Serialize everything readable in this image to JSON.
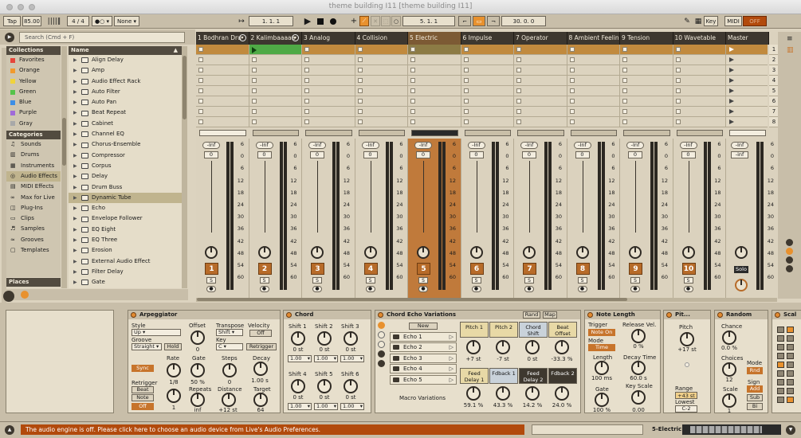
{
  "window": {
    "title": "theme building I11  [theme building I11]"
  },
  "control_bar": {
    "tap": "Tap",
    "tempo": "85.00",
    "time_sig": "4 / 4",
    "metronome": "1 Bar",
    "quantize": "None",
    "arrangement_pos": "1.   1.   1",
    "loop_start": "5.   1.   1",
    "loop_length": "30.   0.   0",
    "key_label": "Key",
    "midi_label": "MIDI",
    "cpu": "OFF"
  },
  "browser": {
    "search_placeholder": "Search (Cmd + F)",
    "collections_header": "Collections",
    "collections": [
      {
        "label": "Favorites",
        "color": "#e6453a"
      },
      {
        "label": "Orange",
        "color": "#f19a2d"
      },
      {
        "label": "Yellow",
        "color": "#f0d33b"
      },
      {
        "label": "Green",
        "color": "#55c34a"
      },
      {
        "label": "Blue",
        "color": "#3d8fe6"
      },
      {
        "label": "Purple",
        "color": "#a06ad8"
      },
      {
        "label": "Gray",
        "color": "#a8a8a8"
      }
    ],
    "categories_header": "Categories",
    "categories": [
      "Sounds",
      "Drums",
      "Instruments",
      "Audio Effects",
      "MIDI Effects",
      "Max for Live",
      "Plug-Ins",
      "Clips",
      "Samples",
      "Grooves",
      "Templates"
    ],
    "places_header": "Places",
    "name_header": "Name",
    "items": [
      "Align Delay",
      "Amp",
      "Audio Effect Rack",
      "Auto Filter",
      "Auto Pan",
      "Beat Repeat",
      "Cabinet",
      "Channel EQ",
      "Chorus-Ensemble",
      "Compressor",
      "Corpus",
      "Delay",
      "Drum Buss",
      "Dynamic Tube",
      "Echo",
      "Envelope Follower",
      "EQ Eight",
      "EQ Three",
      "Erosion",
      "External Audio Effect",
      "Filter Delay",
      "Gate"
    ]
  },
  "tracks": [
    {
      "name": "1 Bodhran Dru",
      "num": "1",
      "vol": "-Inf",
      "pan": "0"
    },
    {
      "name": "2 Kalimbaaaaa",
      "num": "2",
      "vol": "-Inf",
      "pan": "0"
    },
    {
      "name": "3 Analog",
      "num": "3",
      "vol": "-Inf",
      "pan": "0"
    },
    {
      "name": "4 Collision",
      "num": "4",
      "vol": "-Inf",
      "pan": "0"
    },
    {
      "name": "5 Electric",
      "num": "5",
      "vol": "-Inf",
      "pan": "0"
    },
    {
      "name": "6 Impulse",
      "num": "6",
      "vol": "-Inf",
      "pan": "0"
    },
    {
      "name": "7 Operator",
      "num": "7",
      "vol": "-Inf",
      "pan": "0"
    },
    {
      "name": "8 Ambient Feelin",
      "num": "8",
      "vol": "-Inf",
      "pan": "0"
    },
    {
      "name": "9 Tension",
      "num": "9",
      "vol": "-Inf",
      "pan": "0"
    },
    {
      "name": "10 Wavetable",
      "num": "10",
      "vol": "-Inf",
      "pan": "0"
    }
  ],
  "master": {
    "name": "Master",
    "vol": "-Inf",
    "pan": "-inf",
    "solo": "Solo"
  },
  "scenes": [
    "1",
    "2",
    "3",
    "4",
    "5",
    "6",
    "7",
    "8"
  ],
  "scale": [
    "6",
    "0",
    "6",
    "12",
    "18",
    "24",
    "30",
    "36",
    "42",
    "48",
    "54",
    "60"
  ],
  "mix_buttons": {
    "solo": "S"
  },
  "devices": {
    "arpeggiator": {
      "title": "Arpeggiator",
      "style_label": "Style",
      "style": "Up",
      "groove_label": "Groove",
      "groove": "Straight",
      "hold": "Hold",
      "offset_label": "Offset",
      "offset": "0",
      "transpose_label": "Transpose",
      "transpose": "Shift",
      "key_label": "Key",
      "key": "C",
      "velocity_label": "Velocity",
      "velocity": "Off",
      "retrigger_btn": "Retrigger",
      "sync": "Sync",
      "rate_label": "Rate",
      "rate": "1/8",
      "gate_label": "Gate",
      "gate": "50 %",
      "steps_label": "Steps",
      "steps": "0",
      "decay_label": "Decay",
      "decay": "1.00 s",
      "retrigger_label": "Retrigger",
      "retrig_beat": "Beat",
      "retrig_note": "Note",
      "retrig_off": "Off",
      "repeats_label": "Repeats",
      "repeats": "inf",
      "distance_label": "Distance",
      "distance": "+12 st",
      "target_label": "Target",
      "target": "64",
      "knob1": "1"
    },
    "chord": {
      "title": "Chord",
      "shifts": [
        {
          "label": "Shift 1",
          "val": "0 st",
          "vel": "1.00"
        },
        {
          "label": "Shift 2",
          "val": "0 st",
          "vel": "1.00"
        },
        {
          "label": "Shift 3",
          "val": "0 st",
          "vel": "1.00"
        },
        {
          "label": "Shift 4",
          "val": "0 st",
          "vel": "1.00"
        },
        {
          "label": "Shift 5",
          "val": "0 st",
          "vel": "1.00"
        },
        {
          "label": "Shift 6",
          "val": "0 st",
          "vel": "1.00"
        }
      ]
    },
    "rack": {
      "title": "Chord Echo Variations",
      "rand": "Rand",
      "map": "Map",
      "new": "New",
      "chains": [
        "Echo 1",
        "Echo 2",
        "Echo 3",
        "Echo 4",
        "Echo 5"
      ],
      "macro_variations": "Macro Variations",
      "macros": [
        {
          "label": "Pitch 1",
          "val": "+7 st"
        },
        {
          "label": "Pitch 2",
          "val": "-7 st"
        },
        {
          "label": "Chord Shift",
          "val": "0 st"
        },
        {
          "label": "Beat Offset",
          "val": "-33.3 %"
        },
        {
          "label": "Feed Delay 1",
          "val": "59.1 %"
        },
        {
          "label": "Fdback 1",
          "val": "43.3 %"
        },
        {
          "label": "Feed Delay 2",
          "val": "14.2 %"
        },
        {
          "label": "Fdback 2",
          "val": "24.0 %"
        }
      ]
    },
    "note_length": {
      "title": "Note Length",
      "trigger_label": "Trigger",
      "trigger": "Note On",
      "release_label": "Release Vel.",
      "release": "0 %",
      "mode_label": "Mode",
      "mode": "Time",
      "length_label": "Length",
      "length": "100 ms",
      "decay_label": "Decay Time",
      "decay": "60.0 s",
      "gate_label": "Gate",
      "gate": "100 %",
      "keyscale_label": "Key Scale",
      "keyscale": "0.00"
    },
    "pitch": {
      "title": "Pit...",
      "pitch_label": "Pitch",
      "pitch": "+17 st",
      "range_label": "Range",
      "range": "+43 st",
      "lowest_label": "Lowest",
      "lowest": "C-2"
    },
    "random": {
      "title": "Random",
      "chance_label": "Chance",
      "chance": "0.0 %",
      "choices_label": "Choices",
      "choices": "12",
      "scale_label": "Scale",
      "scale": "1",
      "mode_label": "Mode",
      "mode": "Rnd",
      "sign_label": "Sign",
      "sign_add": "Add",
      "sign_sub": "Sub",
      "sign_bi": "Bi"
    },
    "scale_dev": {
      "title": "Scal"
    }
  },
  "status": {
    "message": "The audio engine is off. Please click here to choose an audio device from Live's Audio Preferences.",
    "track": "5-Electric"
  }
}
